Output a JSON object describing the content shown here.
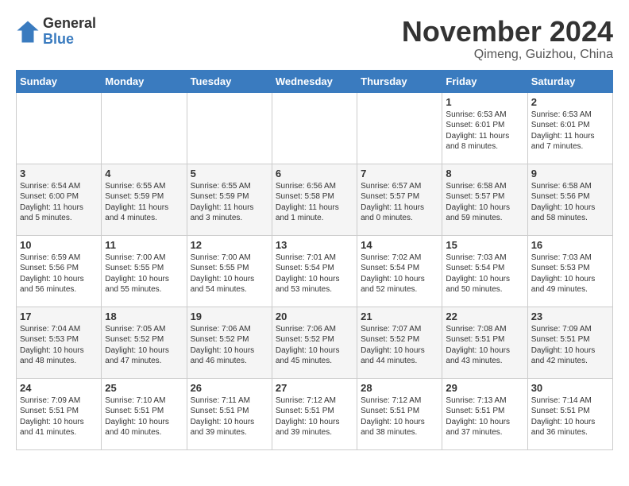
{
  "logo": {
    "general": "General",
    "blue": "Blue"
  },
  "title": "November 2024",
  "location": "Qimeng, Guizhou, China",
  "headers": [
    "Sunday",
    "Monday",
    "Tuesday",
    "Wednesday",
    "Thursday",
    "Friday",
    "Saturday"
  ],
  "weeks": [
    [
      {
        "day": "",
        "info": ""
      },
      {
        "day": "",
        "info": ""
      },
      {
        "day": "",
        "info": ""
      },
      {
        "day": "",
        "info": ""
      },
      {
        "day": "",
        "info": ""
      },
      {
        "day": "1",
        "info": "Sunrise: 6:53 AM\nSunset: 6:01 PM\nDaylight: 11 hours\nand 8 minutes."
      },
      {
        "day": "2",
        "info": "Sunrise: 6:53 AM\nSunset: 6:01 PM\nDaylight: 11 hours\nand 7 minutes."
      }
    ],
    [
      {
        "day": "3",
        "info": "Sunrise: 6:54 AM\nSunset: 6:00 PM\nDaylight: 11 hours\nand 5 minutes."
      },
      {
        "day": "4",
        "info": "Sunrise: 6:55 AM\nSunset: 5:59 PM\nDaylight: 11 hours\nand 4 minutes."
      },
      {
        "day": "5",
        "info": "Sunrise: 6:55 AM\nSunset: 5:59 PM\nDaylight: 11 hours\nand 3 minutes."
      },
      {
        "day": "6",
        "info": "Sunrise: 6:56 AM\nSunset: 5:58 PM\nDaylight: 11 hours\nand 1 minute."
      },
      {
        "day": "7",
        "info": "Sunrise: 6:57 AM\nSunset: 5:57 PM\nDaylight: 11 hours\nand 0 minutes."
      },
      {
        "day": "8",
        "info": "Sunrise: 6:58 AM\nSunset: 5:57 PM\nDaylight: 10 hours\nand 59 minutes."
      },
      {
        "day": "9",
        "info": "Sunrise: 6:58 AM\nSunset: 5:56 PM\nDaylight: 10 hours\nand 58 minutes."
      }
    ],
    [
      {
        "day": "10",
        "info": "Sunrise: 6:59 AM\nSunset: 5:56 PM\nDaylight: 10 hours\nand 56 minutes."
      },
      {
        "day": "11",
        "info": "Sunrise: 7:00 AM\nSunset: 5:55 PM\nDaylight: 10 hours\nand 55 minutes."
      },
      {
        "day": "12",
        "info": "Sunrise: 7:00 AM\nSunset: 5:55 PM\nDaylight: 10 hours\nand 54 minutes."
      },
      {
        "day": "13",
        "info": "Sunrise: 7:01 AM\nSunset: 5:54 PM\nDaylight: 10 hours\nand 53 minutes."
      },
      {
        "day": "14",
        "info": "Sunrise: 7:02 AM\nSunset: 5:54 PM\nDaylight: 10 hours\nand 52 minutes."
      },
      {
        "day": "15",
        "info": "Sunrise: 7:03 AM\nSunset: 5:54 PM\nDaylight: 10 hours\nand 50 minutes."
      },
      {
        "day": "16",
        "info": "Sunrise: 7:03 AM\nSunset: 5:53 PM\nDaylight: 10 hours\nand 49 minutes."
      }
    ],
    [
      {
        "day": "17",
        "info": "Sunrise: 7:04 AM\nSunset: 5:53 PM\nDaylight: 10 hours\nand 48 minutes."
      },
      {
        "day": "18",
        "info": "Sunrise: 7:05 AM\nSunset: 5:52 PM\nDaylight: 10 hours\nand 47 minutes."
      },
      {
        "day": "19",
        "info": "Sunrise: 7:06 AM\nSunset: 5:52 PM\nDaylight: 10 hours\nand 46 minutes."
      },
      {
        "day": "20",
        "info": "Sunrise: 7:06 AM\nSunset: 5:52 PM\nDaylight: 10 hours\nand 45 minutes."
      },
      {
        "day": "21",
        "info": "Sunrise: 7:07 AM\nSunset: 5:52 PM\nDaylight: 10 hours\nand 44 minutes."
      },
      {
        "day": "22",
        "info": "Sunrise: 7:08 AM\nSunset: 5:51 PM\nDaylight: 10 hours\nand 43 minutes."
      },
      {
        "day": "23",
        "info": "Sunrise: 7:09 AM\nSunset: 5:51 PM\nDaylight: 10 hours\nand 42 minutes."
      }
    ],
    [
      {
        "day": "24",
        "info": "Sunrise: 7:09 AM\nSunset: 5:51 PM\nDaylight: 10 hours\nand 41 minutes."
      },
      {
        "day": "25",
        "info": "Sunrise: 7:10 AM\nSunset: 5:51 PM\nDaylight: 10 hours\nand 40 minutes."
      },
      {
        "day": "26",
        "info": "Sunrise: 7:11 AM\nSunset: 5:51 PM\nDaylight: 10 hours\nand 39 minutes."
      },
      {
        "day": "27",
        "info": "Sunrise: 7:12 AM\nSunset: 5:51 PM\nDaylight: 10 hours\nand 39 minutes."
      },
      {
        "day": "28",
        "info": "Sunrise: 7:12 AM\nSunset: 5:51 PM\nDaylight: 10 hours\nand 38 minutes."
      },
      {
        "day": "29",
        "info": "Sunrise: 7:13 AM\nSunset: 5:51 PM\nDaylight: 10 hours\nand 37 minutes."
      },
      {
        "day": "30",
        "info": "Sunrise: 7:14 AM\nSunset: 5:51 PM\nDaylight: 10 hours\nand 36 minutes."
      }
    ]
  ]
}
